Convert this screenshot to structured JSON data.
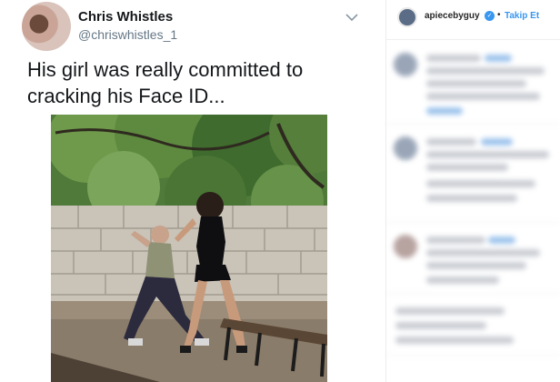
{
  "tweet": {
    "name": "Chris Whistles",
    "handle": "@chriswhistles_1",
    "text": "His girl was really committed to cracking his Face ID..."
  },
  "instagram": {
    "username": "apiecebyguy",
    "dot": "•",
    "follow_label": "Takip Et"
  },
  "colors": {
    "text_primary": "#14171a",
    "text_secondary": "#657786",
    "ig_blue": "#3897f0"
  }
}
